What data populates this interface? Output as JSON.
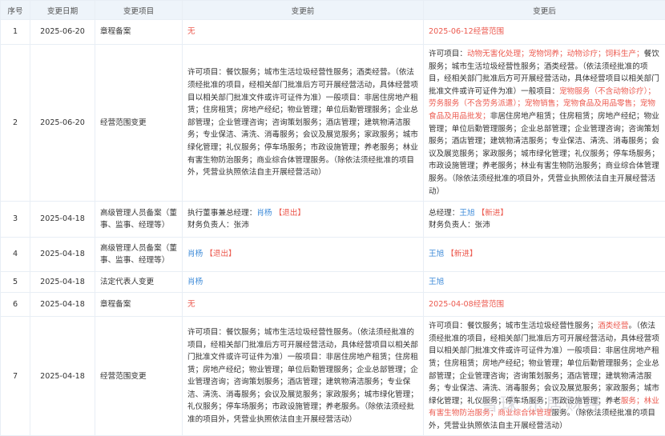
{
  "headers": [
    "序号",
    "变更日期",
    "变更项目",
    "变更前",
    "变更后"
  ],
  "rows": [
    {
      "no": "1",
      "date": "2025-06-20",
      "item": "章程备案",
      "before": [
        {
          "t": "无",
          "c": "red"
        }
      ],
      "after": [
        {
          "t": "2025-06-12经营范围",
          "c": "red"
        }
      ]
    },
    {
      "no": "2",
      "date": "2025-06-20",
      "item": "经营范围变更",
      "before": [
        {
          "t": "许可项目：餐饮服务；城市生活垃圾经营性服务；酒类经营。（依法须经批准的项目，经相关部门批准后方可开展经营活动，具体经营项目以相关部门批准文件或许可证件为准）一般项目：非居住房地产租赁；住房租赁；房地产经纪；物业管理；单位后勤管理服务；企业总部管理；企业管理咨询；咨询策划服务；酒店管理；建筑物清洁服务；专业保洁、清洗、消毒服务；会议及展览服务；家政服务；城市绿化管理；礼仪服务；停车场服务；市政设施管理；养老服务；林业有害生物防治服务；商业综合体管理服务。（除依法须经批准的项目外，凭营业执照依法自主开展经营活动）",
          "c": ""
        }
      ],
      "after": [
        {
          "t": "许可项目：",
          "c": ""
        },
        {
          "t": "动物无害化处理；宠物饲养；动物诊疗；饲料生产；",
          "c": "red"
        },
        {
          "t": "餐饮服务；城市生活垃圾经营性服务；酒类经营。（依法须经批准的项目，经相关部门批准后方可开展经营活动，具体经营项目以相关部门批准文件或许可证件为准）一般项目：",
          "c": ""
        },
        {
          "t": "宠物服务（不含动物诊疗）；劳务服务（不含劳务派遣）；宠物销售；宠物食品及用品零售；宠物食品及用品批发；",
          "c": "red"
        },
        {
          "t": "非居住房地产租赁；住房租赁；房地产经纪；物业管理；单位后勤管理服务；企业总部管理；企业管理咨询；咨询策划服务；酒店管理；建筑物清洁服务；专业保洁、清洗、消毒服务；会议及展览服务；家政服务；城市绿化管理；礼仪服务；停车场服务；市政设施管理；养老服务；林业有害生物防治服务；商业综合体管理服务。（除依法须经批准的项目外，凭营业执照依法自主开展经营活动）",
          "c": ""
        }
      ]
    },
    {
      "no": "3",
      "date": "2025-04-18",
      "item": "高级管理人员备案（董事、监事、经理等）",
      "before": [
        {
          "t": "执行董事兼总经理：",
          "c": ""
        },
        {
          "t": "肖杨",
          "c": "blue"
        },
        {
          "t": " 【退出】",
          "c": "red"
        },
        {
          "t": "\n财务负责人：张沛",
          "c": ""
        }
      ],
      "after": [
        {
          "t": "总经理：",
          "c": ""
        },
        {
          "t": "王旭",
          "c": "blue"
        },
        {
          "t": " 【新进】",
          "c": "red"
        },
        {
          "t": "\n财务负责人：张沛",
          "c": ""
        }
      ]
    },
    {
      "no": "4",
      "date": "2025-04-18",
      "item": "高级管理人员备案（董事、监事、经理等）",
      "before": [
        {
          "t": "肖杨",
          "c": "blue"
        },
        {
          "t": " 【退出】",
          "c": "red"
        }
      ],
      "after": [
        {
          "t": "王旭",
          "c": "blue"
        },
        {
          "t": " 【新进】",
          "c": "red"
        }
      ]
    },
    {
      "no": "5",
      "date": "2025-04-18",
      "item": "法定代表人变更",
      "before": [
        {
          "t": "肖杨",
          "c": "blue"
        }
      ],
      "after": [
        {
          "t": "王旭",
          "c": "blue"
        }
      ]
    },
    {
      "no": "6",
      "date": "2025-04-18",
      "item": "章程备案",
      "before": [
        {
          "t": "无",
          "c": "red"
        }
      ],
      "after": [
        {
          "t": "2025-04-08经营范围",
          "c": "red"
        }
      ]
    },
    {
      "no": "7",
      "date": "2025-04-18",
      "item": "经营范围变更",
      "before": [
        {
          "t": "许可项目：餐饮服务；城市生活垃圾经营性服务。（依法须经批准的项目，经相关部门批准后方可开展经营活动，具体经营项目以相关部门批准文件或许可证件为准）一般项目：非居住房地产租赁；住房租赁；房地产经纪；物业管理；单位后勤管理服务；企业总部管理；企业管理咨询；咨询策划服务；酒店管理；建筑物清洁服务；专业保洁、清洗、消毒服务；会议及展览服务；家政服务；城市绿化管理；礼仪服务；停车场服务；市政设施管理；养老服务。（除依法须经批准的项目外，凭营业执照依法自主开展经营活动）",
          "c": ""
        }
      ],
      "after": [
        {
          "t": "许可项目：餐饮服务；城市生活垃圾经营性服务；",
          "c": ""
        },
        {
          "t": "酒类经营",
          "c": "red"
        },
        {
          "t": "。（依法须经批准的项目，经相关部门批准后方可开展经营活动，具体经营项目以相关部门批准文件或许可证件为准）一般项目：非居住房地产租赁；住房租赁；房地产经纪；物业管理；单位后勤管理服务；企业总部管理；企业管理咨询；咨询策划服务；酒店管理；建筑物清洁服务；专业保洁、清洗、消毒服务；会议及展览服务；家政服务；城市绿化管理；礼仪服务；停车场服务；市政设施管理；养老",
          "c": ""
        },
        {
          "t": "服务；林业有害生物防治服务；商业综合体管理",
          "c": "red"
        },
        {
          "t": "服务。（除依法须经批准的项目外，凭营业执照依法自主开展经营活动）",
          "c": ""
        }
      ]
    }
  ],
  "watermark": "雪球 乐居财经",
  "colors": {
    "red": "#ec5a4f",
    "blue": "#3c8ad8",
    "header_bg": "#eef4fa"
  }
}
